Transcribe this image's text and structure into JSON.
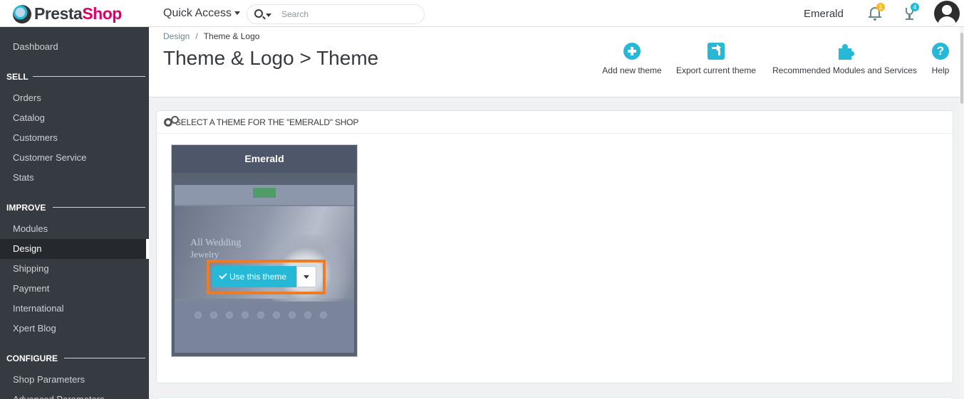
{
  "header": {
    "logo_a": "Presta",
    "logo_b": "Shop",
    "quick_access": "Quick Access",
    "search_placeholder": "Search",
    "shop_name": "Emerald",
    "notifications_count": "1",
    "orders_count": "4"
  },
  "sidebar": {
    "dashboard": "Dashboard",
    "sections": {
      "sell": "SELL",
      "improve": "IMPROVE",
      "configure": "CONFIGURE"
    },
    "sell_items": [
      "Orders",
      "Catalog",
      "Customers",
      "Customer Service",
      "Stats"
    ],
    "improve_items": [
      "Modules",
      "Design",
      "Shipping",
      "Payment",
      "International",
      "Xpert Blog"
    ],
    "configure_items": [
      "Shop Parameters",
      "Advanced Parameters"
    ],
    "active": "Design"
  },
  "breadcrumb": {
    "parent": "Design",
    "separator": "/",
    "current": "Theme & Logo"
  },
  "page_title": "Theme & Logo > Theme",
  "toolbar": {
    "add_new_theme": "Add new theme",
    "export_current_theme": "Export current theme",
    "recommended_modules": "Recommended Modules and Services",
    "help": "Help",
    "help_glyph": "?"
  },
  "panel": {
    "heading": "SELECT A THEME FOR THE \"EMERALD\" SHOP"
  },
  "theme_card": {
    "name": "Emerald",
    "preview_line1": "All Wedding",
    "preview_line2": "Jewelry",
    "use_button": "Use this theme"
  },
  "colors": {
    "accent": "#25b9d7",
    "brand_pink": "#df0067",
    "sidebar_bg": "#363a41",
    "highlight": "#f07b23"
  }
}
